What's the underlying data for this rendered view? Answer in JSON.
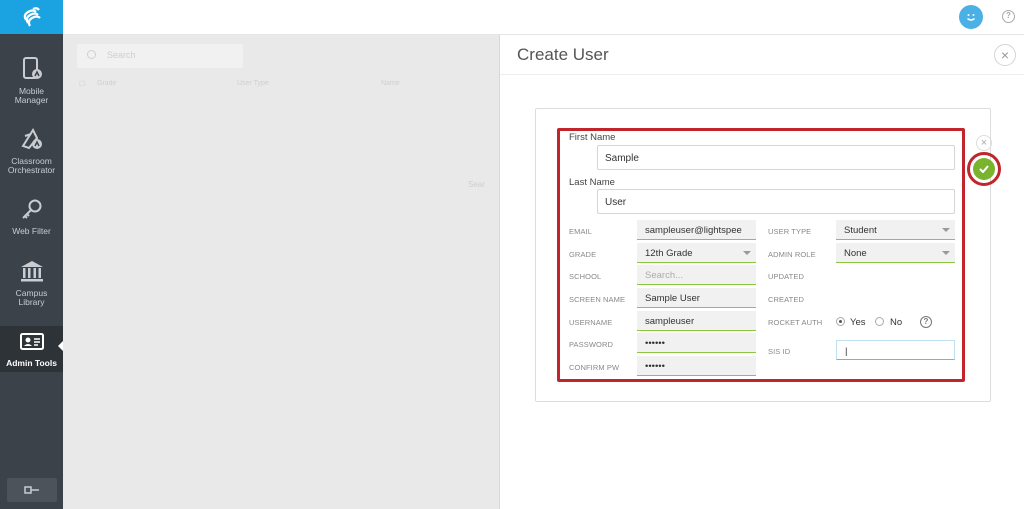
{
  "sidebar": {
    "items": [
      {
        "label": "Mobile\nManager",
        "icon": "mobile-manager-icon"
      },
      {
        "label": "Classroom\nOrchestrator",
        "icon": "classroom-orchestrator-icon"
      },
      {
        "label": "Web Filter",
        "icon": "key-icon"
      },
      {
        "label": "Campus\nLibrary",
        "icon": "library-building-icon"
      },
      {
        "label": "Admin Tools",
        "icon": "admin-id-card-icon",
        "active": true
      }
    ]
  },
  "background": {
    "search_placeholder": "Search",
    "columns": [
      "Grade",
      "User Type",
      "Name"
    ],
    "hint": "Sear"
  },
  "panel": {
    "title": "Create User",
    "first_name_label": "First Name",
    "first_name_value": "Sample",
    "last_name_label": "Last Name",
    "last_name_value": "User",
    "left_fields": [
      {
        "label": "EMAIL",
        "value": "sampleuser@lightspee"
      },
      {
        "label": "GRADE",
        "value": "12th Grade",
        "dropdown": true
      },
      {
        "label": "SCHOOL",
        "value": "Search...",
        "placeholder": true
      },
      {
        "label": "SCREEN NAME",
        "value": "Sample User"
      },
      {
        "label": "USERNAME",
        "value": "sampleuser"
      },
      {
        "label": "PASSWORD",
        "value": "••••••"
      },
      {
        "label": "CONFIRM PW",
        "value": "••••••"
      }
    ],
    "right_fields": {
      "user_type_label": "USER TYPE",
      "user_type_value": "Student",
      "admin_role_label": "ADMIN ROLE",
      "admin_role_value": "None",
      "updated_label": "UPDATED",
      "created_label": "CREATED",
      "rocket_auth_label": "ROCKET AUTH",
      "rocket_auth_yes": "Yes",
      "rocket_auth_no": "No",
      "rocket_auth_selected": "Yes",
      "sis_id_label": "SIS ID",
      "sis_id_value": "|"
    }
  },
  "colors": {
    "sidebar_bg": "#3c4249",
    "logo_bg": "#1aa3e0",
    "highlight": "#c0252b",
    "confirm": "#7ab32e",
    "field_underline": "#8cc63f"
  }
}
